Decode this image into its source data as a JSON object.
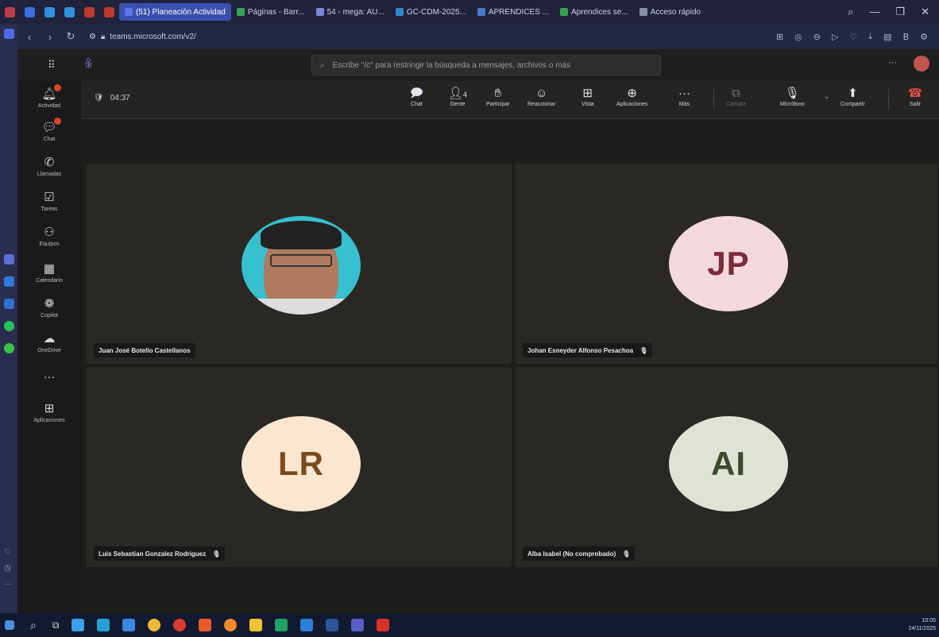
{
  "browser": {
    "tabs": [
      {
        "label": "(51) Planeación Actividad",
        "color": "#5a76e8",
        "active": true
      },
      {
        "label": "Páginas - Barr...",
        "color": "#36a35a",
        "active": false
      },
      {
        "label": "54 - mega: AU...",
        "color": "#7b86d6",
        "active": false
      },
      {
        "label": "GC-CDM-2025...",
        "color": "#2f87d0",
        "active": false
      },
      {
        "label": "APRENDICES ...",
        "color": "#4a79c8",
        "active": false
      },
      {
        "label": "Aprendices se...",
        "color": "#3aa049",
        "active": false
      },
      {
        "label": "Acceso rápido",
        "color": "#8a8fa8",
        "active": false
      }
    ],
    "window_controls": [
      "—",
      "❐",
      "✕"
    ],
    "url": "teams.microsoft.com/v2/"
  },
  "teams": {
    "search_placeholder": "Escribe \"/c\" para restringir la búsqueda a mensajes, archivos o más",
    "more": "···",
    "rail": [
      {
        "label": "Actividad",
        "icon": "bell-icon",
        "badge": true
      },
      {
        "label": "Chat",
        "icon": "chat-icon",
        "badge": true
      },
      {
        "label": "Llamadas",
        "icon": "phone-icon",
        "badge": false
      },
      {
        "label": "Tareas",
        "icon": "tasks-icon",
        "badge": false
      },
      {
        "label": "Equipos",
        "icon": "teams-icon",
        "badge": false
      },
      {
        "label": "Calendario",
        "icon": "calendar-icon",
        "badge": false
      },
      {
        "label": "Copilot",
        "icon": "copilot-icon",
        "badge": false
      },
      {
        "label": "OneDrive",
        "icon": "cloud-icon",
        "badge": false
      },
      {
        "label": "",
        "icon": "more-icon",
        "badge": false
      },
      {
        "label": "Aplicaciones",
        "icon": "apps-icon",
        "badge": false
      }
    ]
  },
  "call": {
    "timer": "04:37",
    "controls": [
      {
        "label": "Chat",
        "icon": "chat-icon"
      },
      {
        "label": "Gente",
        "icon": "people-icon",
        "count": "4"
      },
      {
        "label": "Participar",
        "icon": "raise-hand-icon"
      },
      {
        "label": "Reaccionar",
        "icon": "emoji-icon"
      },
      {
        "label": "Vista",
        "icon": "grid-icon"
      },
      {
        "label": "Aplicaciones",
        "icon": "apps-icon"
      },
      {
        "label": "Más",
        "icon": "more-icon"
      }
    ],
    "camera_label": "Cámara",
    "mic_label": "Micrófono",
    "share_label": "Compartir",
    "leave_label": "Salir"
  },
  "participants": [
    {
      "name": "Juan José Botello Castellanos",
      "initials": "",
      "photo": true,
      "muted": false,
      "avatar_bg": "#36c0d0",
      "avatar_fg": "#000000"
    },
    {
      "name": "Johan Esneyder Alfonso Pesachoa",
      "initials": "JP",
      "photo": false,
      "muted": true,
      "avatar_bg": "#f3d9dc",
      "avatar_fg": "#7a2a3a"
    },
    {
      "name": "Luis Sebastian Gonzalez Rodriguez",
      "initials": "LR",
      "photo": false,
      "muted": true,
      "avatar_bg": "#fbe6cf",
      "avatar_fg": "#7a4a1e"
    },
    {
      "name": "Alba Isabel (No comprobado)",
      "initials": "AI",
      "photo": false,
      "muted": true,
      "avatar_bg": "#dfe3d6",
      "avatar_fg": "#3a4a2a"
    }
  ],
  "taskbar": {
    "time": "10:05",
    "date": "24/11/2025"
  },
  "colors": {
    "accent": "#4f6bed",
    "leave": "#e0504a"
  }
}
